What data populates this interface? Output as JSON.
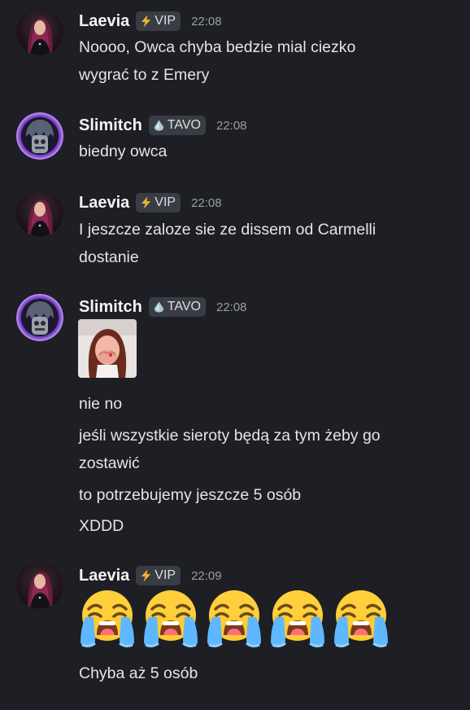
{
  "messages": [
    {
      "username": "Laevia",
      "badge": "VIP",
      "badge_icon": "lightning-icon",
      "time": "22:08",
      "lines": [
        "Noooo, Owca chyba bedzie mial ciezko",
        "wygrać to z Emery"
      ]
    },
    {
      "username": "Slimitch",
      "badge": "TAVO",
      "badge_icon": "water-drop-icon",
      "time": "22:08",
      "lines": [
        "biedny owca"
      ]
    },
    {
      "username": "Laevia",
      "badge": "VIP",
      "badge_icon": "lightning-icon",
      "time": "22:08",
      "lines": [
        "I jeszcze zaloze sie ze dissem od Carmelli",
        "dostanie"
      ]
    },
    {
      "username": "Slimitch",
      "badge": "TAVO",
      "badge_icon": "water-drop-icon",
      "time": "22:08",
      "sticker": "crying-woman-sticker",
      "lines": [
        "nie no",
        "jeśli wszystkie sieroty będą za tym żeby go",
        "zostawić",
        "to potrzebujemy jeszcze 5 osób",
        "XDDD"
      ]
    },
    {
      "username": "Laevia",
      "badge": "VIP",
      "badge_icon": "lightning-icon",
      "time": "22:09",
      "emojis": [
        "loudly-crying-face",
        "loudly-crying-face",
        "loudly-crying-face",
        "loudly-crying-face",
        "loudly-crying-face"
      ],
      "lines": [
        "Chyba aż 5 osób"
      ]
    }
  ],
  "colors": {
    "background": "#1e1f24",
    "badge_bg": "#3a3c43",
    "text": "#e3e5e8",
    "timestamp": "#9a9da5",
    "vip_bolt": "#f0b232",
    "tavo_drop": "#a8c8d8"
  }
}
